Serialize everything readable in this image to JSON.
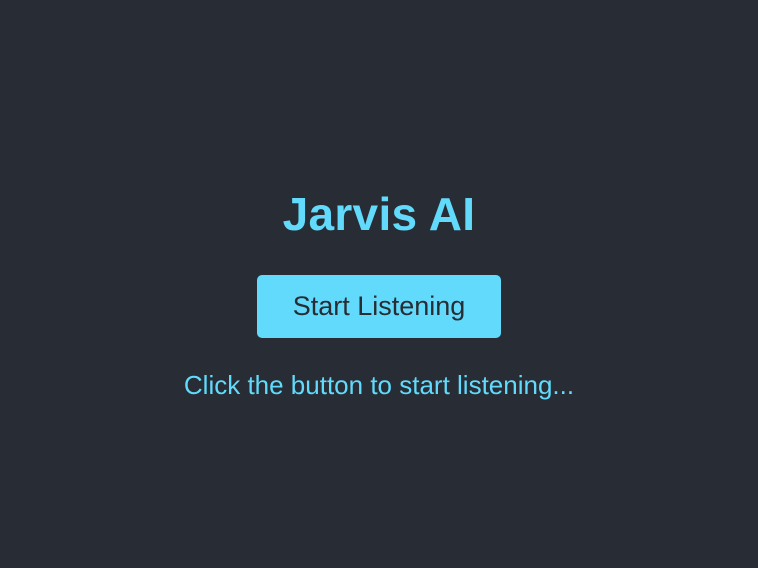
{
  "app": {
    "title": "Jarvis AI",
    "button_label": "Start Listening",
    "status": "Click the button to start listening..."
  },
  "colors": {
    "background": "#282c34",
    "accent": "#61dafb",
    "button_text": "#282c34"
  }
}
